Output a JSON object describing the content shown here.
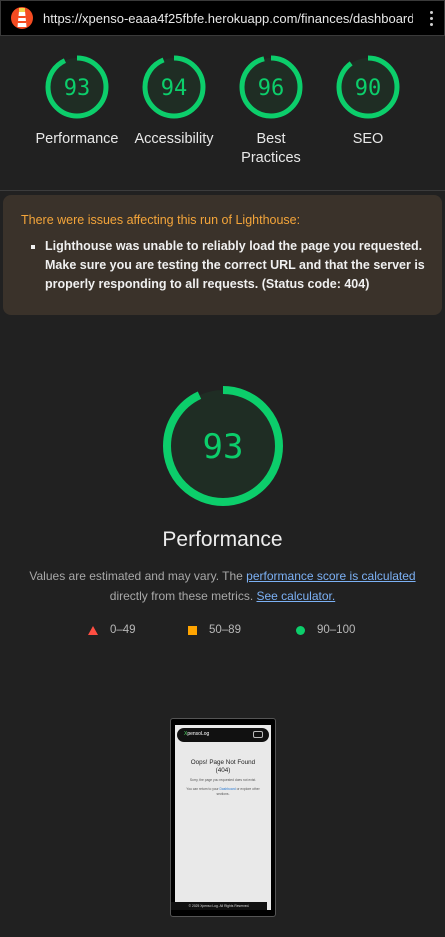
{
  "browser": {
    "url": "https://xpenso-eaaa4f25fbfe.herokuapp.com/finances/dashboard/..."
  },
  "category_scores": [
    {
      "label": "Performance",
      "score": 93
    },
    {
      "label": "Accessibility",
      "score": 94
    },
    {
      "label": "Best Practices",
      "score": 96
    },
    {
      "label": "SEO",
      "score": 90
    }
  ],
  "warning": {
    "title": "There were issues affecting this run of Lighthouse:",
    "items": [
      "Lighthouse was unable to reliably load the page you requested. Make sure you are testing the correct URL and that the server is properly responding to all requests. (Status code: 404)"
    ]
  },
  "main_gauge": {
    "score": 93,
    "title": "Performance"
  },
  "description": {
    "prefix": "Values are estimated and may vary. The ",
    "link1": "performance score is calculated",
    "middle": " directly from these metrics. ",
    "link2": "See calculator."
  },
  "legend": [
    {
      "symbol": "triangle",
      "range": "0–49",
      "color": "#ff4e42"
    },
    {
      "symbol": "square",
      "range": "50–89",
      "color": "#ffa400"
    },
    {
      "symbol": "circle",
      "range": "90–100",
      "color": "#0cce6b"
    }
  ],
  "screenshot": {
    "brand_x": "X",
    "brand_rest": "pensoLog",
    "heading_line1": "Oops! Page Not Found",
    "heading_line2": "(404)",
    "text1": "Sorry, the page you requested does not exist.",
    "text2_a": "You can return to your ",
    "text2_link": "Dashboard",
    "text2_b": " or explore other sections.",
    "footer": "© 2025 Xpenso Log. All Rights Reserved."
  },
  "colors": {
    "pass": "#0cce6b",
    "warning_title": "#f4a53a",
    "background": "#212121",
    "link": "#7cb1f5"
  }
}
